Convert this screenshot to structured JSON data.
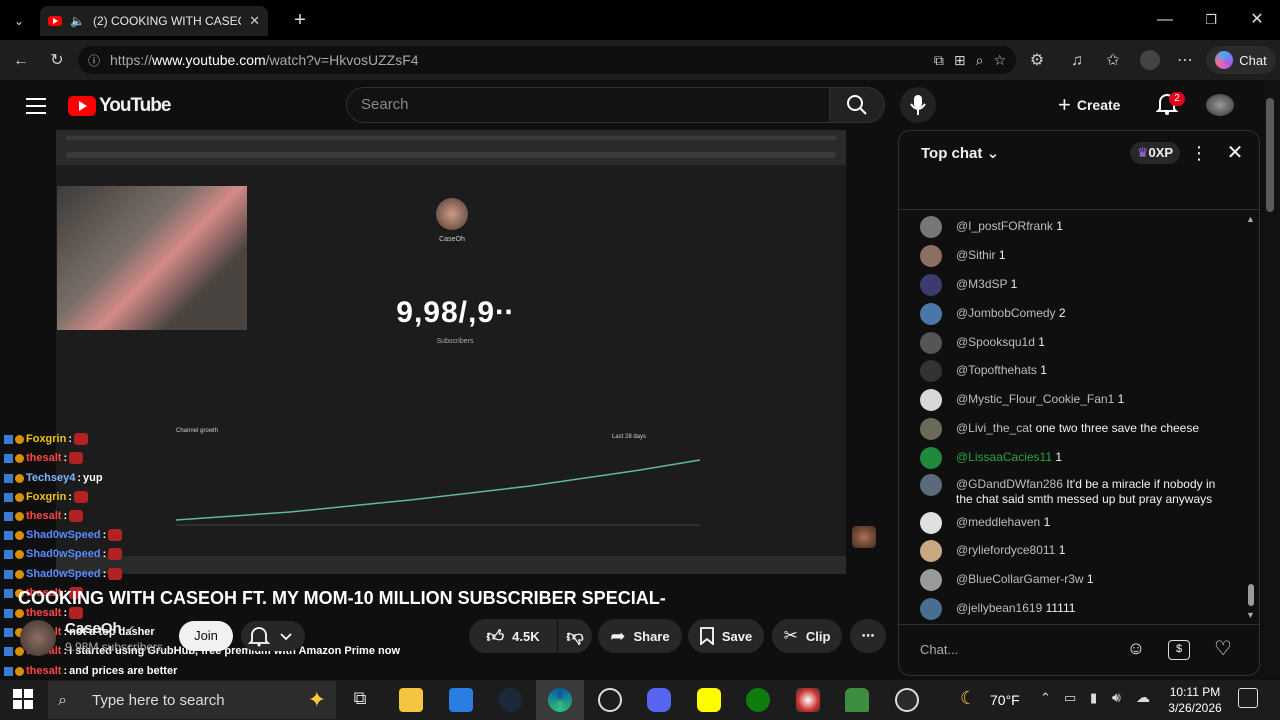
{
  "browser": {
    "tab_title": "(2) COOKING WITH CASEOH F",
    "url_prefix": "https://",
    "url_domain": "www.youtube.com",
    "url_path": "/watch?v=HkvosUZZsF4",
    "chat_label": "Chat"
  },
  "youtube": {
    "logo": "YouTube",
    "search_placeholder": "Search",
    "create_label": "Create",
    "notification_count": "2"
  },
  "video": {
    "overlay_subscriber_count": "9,98",
    "overlay_subscriber_suffix": "/,9∙∙",
    "overlay_subscribers_label": "Subscribers",
    "overlay_channel": "CaseOh",
    "title": "COOKING WITH CASEOH FT. MY MOM-10 MILLION SUBSCRIBER SPECIAL-",
    "channel_name": "CaseOh",
    "subscribers": "9.98M subscribers",
    "join_label": "Join",
    "likes": "4.5K",
    "share_label": "Share",
    "save_label": "Save",
    "clip_label": "Clip",
    "chart_title": "Channel growth",
    "chart_range": "Last 28 days"
  },
  "overlay_chat": [
    {
      "user": "Foxgrin",
      "text": "",
      "color": "#f0c419"
    },
    {
      "user": "thesalt",
      "text": "",
      "color": "#ff4545"
    },
    {
      "user": "Techsey4",
      "text": "yup",
      "color": "#7fb7ff"
    },
    {
      "user": "Foxgrin",
      "text": "",
      "color": "#f0c419"
    },
    {
      "user": "thesalt",
      "text": "",
      "color": "#ff4545"
    },
    {
      "user": "Shad0wSpeed",
      "text": "",
      "color": "#5b8cff"
    },
    {
      "user": "Shad0wSpeed",
      "text": "",
      "color": "#5b8cff"
    },
    {
      "user": "Shad0wSpeed",
      "text": "",
      "color": "#5b8cff"
    },
    {
      "user": "thesalt",
      "text": "",
      "color": "#ff4545"
    },
    {
      "user": "thesalt",
      "text": "",
      "color": "#ff4545"
    },
    {
      "user": "thesalt",
      "text": "not a top dasher",
      "color": "#ff4545"
    },
    {
      "user": "thesalt",
      "text": "I started using GrubHub, free premium with Amazon Prime now",
      "color": "#ff4545"
    },
    {
      "user": "thesalt",
      "text": "and prices are better",
      "color": "#ff4545"
    },
    {
      "user": "thesalt",
      "text": "",
      "color": "#ff4545"
    }
  ],
  "live_chat": {
    "header": "Top chat",
    "xp": "0XP",
    "messages": [
      {
        "author": "@I_postFORfrank",
        "text": "1",
        "color": "#777777"
      },
      {
        "author": "@Sithir",
        "text": "1",
        "color": "#8d6e63"
      },
      {
        "author": "@M3dSP",
        "text": "1",
        "color": "#3b3b6e"
      },
      {
        "author": "@JombobComedy",
        "text": "2",
        "color": "#4a77a8"
      },
      {
        "author": "@Spooksqu1d",
        "text": "1",
        "color": "#555555"
      },
      {
        "author": "@Topofthehats",
        "text": "1",
        "color": "#333333"
      },
      {
        "author": "@Mystic_Flour_Cookie_Fan1",
        "text": "1",
        "color": "#d8d8d8"
      },
      {
        "author": "@Livi_the_cat",
        "text": "one two three save the cheese",
        "color": "#6a6a5a"
      },
      {
        "author": "@LissaaCacies11",
        "text": "1",
        "color": "#1f8a3c"
      },
      {
        "author": "@GDandDWfan286",
        "text": "It'd be a miracle if nobody in the chat said smth messed up but pray anyways",
        "color": "#5a6a7a"
      },
      {
        "author": "@meddlehaven",
        "text": "1",
        "color": "#e0e0e0"
      },
      {
        "author": "@ryliefordyce8011",
        "text": "1",
        "color": "#c8a882"
      },
      {
        "author": "@BlueCollarGamer-r3w",
        "text": "1",
        "color": "#999999"
      },
      {
        "author": "@jellybean1619",
        "text": "11111",
        "color": "#4a6e90"
      }
    ],
    "input_placeholder": "Chat..."
  },
  "taskbar": {
    "search_placeholder": "Type here to search",
    "weather": "70°F",
    "time": "10:11 PM",
    "date": "3/26/2026"
  }
}
